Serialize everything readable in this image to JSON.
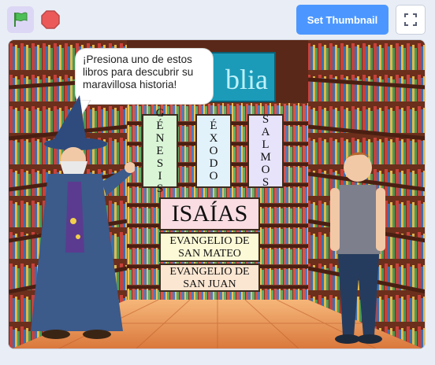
{
  "toolbar": {
    "flag_icon": "green-flag-icon",
    "stop_icon": "stop-sign-icon",
    "thumbnail_label": "Set Thumbnail",
    "fullscreen_icon": "fullscreen-icon"
  },
  "stage": {
    "speech": "¡Presiona uno de estos libros para descubrir su maravillosa historia!",
    "sign_fragment": "blia",
    "books": {
      "genesis": "GÉNESIS",
      "exodo": "ÉXODO",
      "salmos": "SALMOS",
      "isaias": "ISAÍAS",
      "mateo_line1": "EVANGELIO DE",
      "mateo_line2": "SAN MATEO",
      "juan_line1": "EVANGELIO DE",
      "juan_line2": "SAN JUAN"
    }
  },
  "colors": {
    "accent": "#4c97ff",
    "flag_bg": "#dcd7f5",
    "card_green": "#d9f5d6",
    "card_blue": "#e2f2fb",
    "card_lavender": "#e6e3fb",
    "card_pink": "#f9dde3",
    "card_yellow": "#fbf9d6",
    "card_peach": "#fbe6d2"
  }
}
